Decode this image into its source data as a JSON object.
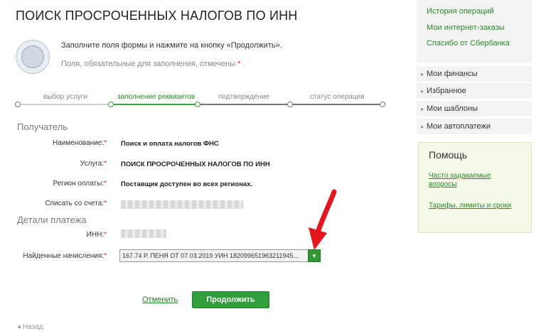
{
  "page": {
    "title": "ПОИСК ПРОСРОЧЕННЫХ НАЛОГОВ ПО ИНН",
    "intro": "Заполните поля формы и нажмите на кнопку «Продолжить».",
    "required_note": "Поля, обязательные для заполнения, отмечены",
    "required_star": "*",
    "required_dot": "."
  },
  "steps": [
    {
      "label": "выбор услуги",
      "state": "done"
    },
    {
      "label": "заполнение реквизитов",
      "state": "active"
    },
    {
      "label": "подтверждение",
      "state": "pending"
    },
    {
      "label": "статус операции",
      "state": "pending"
    }
  ],
  "recipient": {
    "title": "Получатель",
    "name_label": "Наименование:",
    "name_value": "Поиск и оплата налогов ФНС",
    "service_label": "Услуга:",
    "service_value": "ПОИСК ПРОСРОЧЕННЫХ НАЛОГОВ ПО ИНН",
    "region_label": "Регион оплаты:",
    "region_value": "Поставщик доступен во всех регионах.",
    "account_label": "Списать со счета:"
  },
  "payment": {
    "title": "Детали платежа",
    "inn_label": "ИНН:",
    "charges_label": "Найденные начисления:",
    "charges_value": "167.74 Р. ПЕНЯ ОТ 07.03.2019 УИН 182099651963211945..."
  },
  "actions": {
    "cancel": "Отменить",
    "continue": "Продолжить",
    "back": "Назад"
  },
  "sidebar": {
    "links": [
      "История операций",
      "Мои интернет-заказы",
      "Спасибо от Сбербанка"
    ],
    "items": [
      "Мои финансы",
      "Избранное",
      "Мои шаблоны",
      "Мои автоплатежи"
    ],
    "help_title": "Помощь",
    "help_links": [
      "Часто задаваемые вопросы",
      "Тарифы, лимиты и сроки"
    ]
  },
  "colors": {
    "accent_green": "#2f9e3b",
    "required_red": "#e2231a",
    "annotation_arrow_red": "#e8141b"
  }
}
